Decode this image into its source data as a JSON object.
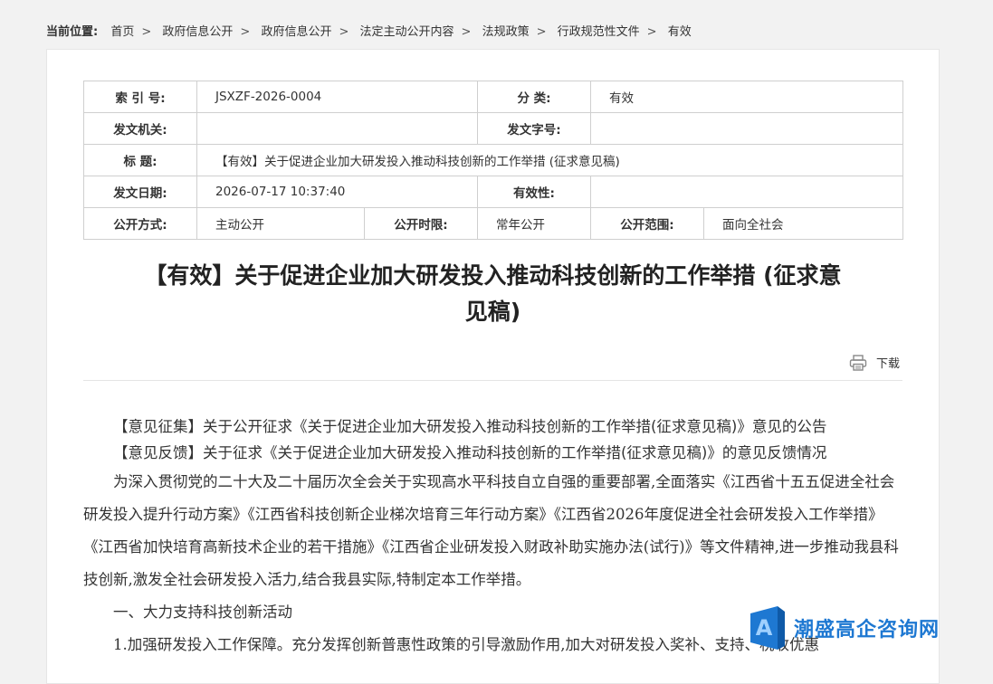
{
  "breadcrumb": {
    "lead": "当前位置:",
    "items": [
      "首页",
      "政府信息公开",
      "政府信息公开",
      "法定主动公开内容",
      "法规政策",
      "行政规范性文件",
      "有效"
    ]
  },
  "meta": {
    "index_label": "索 引 号:",
    "index_value": "JSXZF-2026-0004",
    "category_label": "分 类:",
    "category_value": "有效",
    "issuer_label": "发文机关:",
    "issuer_value": "",
    "docno_label": "发文字号:",
    "docno_value": "",
    "title_label": "标 题:",
    "title_value": "【有效】关于促进企业加大研发投入推动科技创新的工作举措 (征求意见稿)",
    "date_label": "发文日期:",
    "date_value": "2026-07-17 10:37:40",
    "validity_label": "有效性:",
    "validity_value": "",
    "mode_label": "公开方式:",
    "mode_value": "主动公开",
    "period_label": "公开时限:",
    "period_value": "常年公开",
    "scope_label": "公开范围:",
    "scope_value": "面向全社会"
  },
  "doc": {
    "title_line1": "【有效】关于促进企业加大研发投入推动科技创新的工作举措 (征求意",
    "title_line2": "见稿)",
    "download_label": "下载"
  },
  "body": {
    "notice1": "【意见征集】关于公开征求《关于促进企业加大研发投入推动科技创新的工作举措(征求意见稿)》意见的公告",
    "notice2": "【意见反馈】关于征求《关于促进企业加大研发投入推动科技创新的工作举措(征求意见稿)》的意见反馈情况",
    "para1": "为深入贯彻党的二十大及二十届历次全会关于实现高水平科技自立自强的重要部署,全面落实《江西省十五五促进全社会研发投入提升行动方案》《江西省科技创新企业梯次培育三年行动方案》《江西省2026年度促进全社会研发投入工作举措》《江西省加快培育高新技术企业的若干措施》《江西省企业研发投入财政补助实施办法(试行)》等文件精神,进一步推动我县科技创新,激发全社会研发投入活力,结合我县实际,特制定本工作举措。",
    "heading1": "一、大力支持科技创新活动",
    "item1": "1.加强研发投入工作保障。充分发挥创新普惠性政策的引导激励作用,加大对研发投入奖补、支持、税收优惠"
  },
  "watermark": {
    "badge_letter": "A",
    "text": "潮盛高企咨询网"
  }
}
